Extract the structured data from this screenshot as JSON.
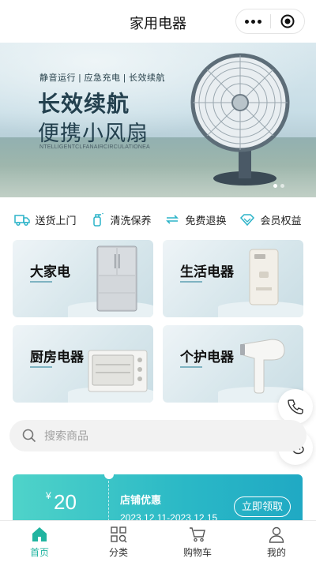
{
  "header": {
    "title": "家用电器"
  },
  "capsule": {
    "more_icon": "more-dots-icon",
    "close_icon": "target-close-icon"
  },
  "banner": {
    "tagline": "静音运行 | 应急充电 | 长效续航",
    "headline": "长效续航",
    "subheadline": "便携小风扇",
    "english": "NTELLIGENTCLFANAIRCIRCULATIONEA",
    "dots": {
      "count": 2,
      "active": 0
    }
  },
  "services": [
    {
      "label": "送货上门",
      "icon": "truck-icon"
    },
    {
      "label": "清洗保养",
      "icon": "spray-bottle-icon"
    },
    {
      "label": "免费退换",
      "icon": "exchange-icon"
    },
    {
      "label": "会员权益",
      "icon": "diamond-icon"
    }
  ],
  "categories": [
    {
      "label": "大家电",
      "product": "refrigerator"
    },
    {
      "label": "生活电器",
      "product": "water-purifier"
    },
    {
      "label": "厨房电器",
      "product": "oven"
    },
    {
      "label": "个护电器",
      "product": "hair-dryer"
    }
  ],
  "float_buttons": [
    {
      "icon": "phone-icon"
    },
    {
      "icon": "wechat-icon"
    }
  ],
  "search": {
    "placeholder": "搜索商品"
  },
  "coupon": {
    "currency": "¥",
    "amount": "20",
    "name": "店铺优惠",
    "date": "2023.12.11-2023.12.15",
    "button": "立即领取"
  },
  "tabbar": {
    "active": 0,
    "items": [
      {
        "label": "首页",
        "icon": "home-icon"
      },
      {
        "label": "分类",
        "icon": "category-icon"
      },
      {
        "label": "购物车",
        "icon": "cart-icon"
      },
      {
        "label": "我的",
        "icon": "user-icon"
      }
    ]
  },
  "colors": {
    "accent": "#21b4a0",
    "coupon_start": "#4fd3c9",
    "coupon_end": "#20a9c4"
  }
}
